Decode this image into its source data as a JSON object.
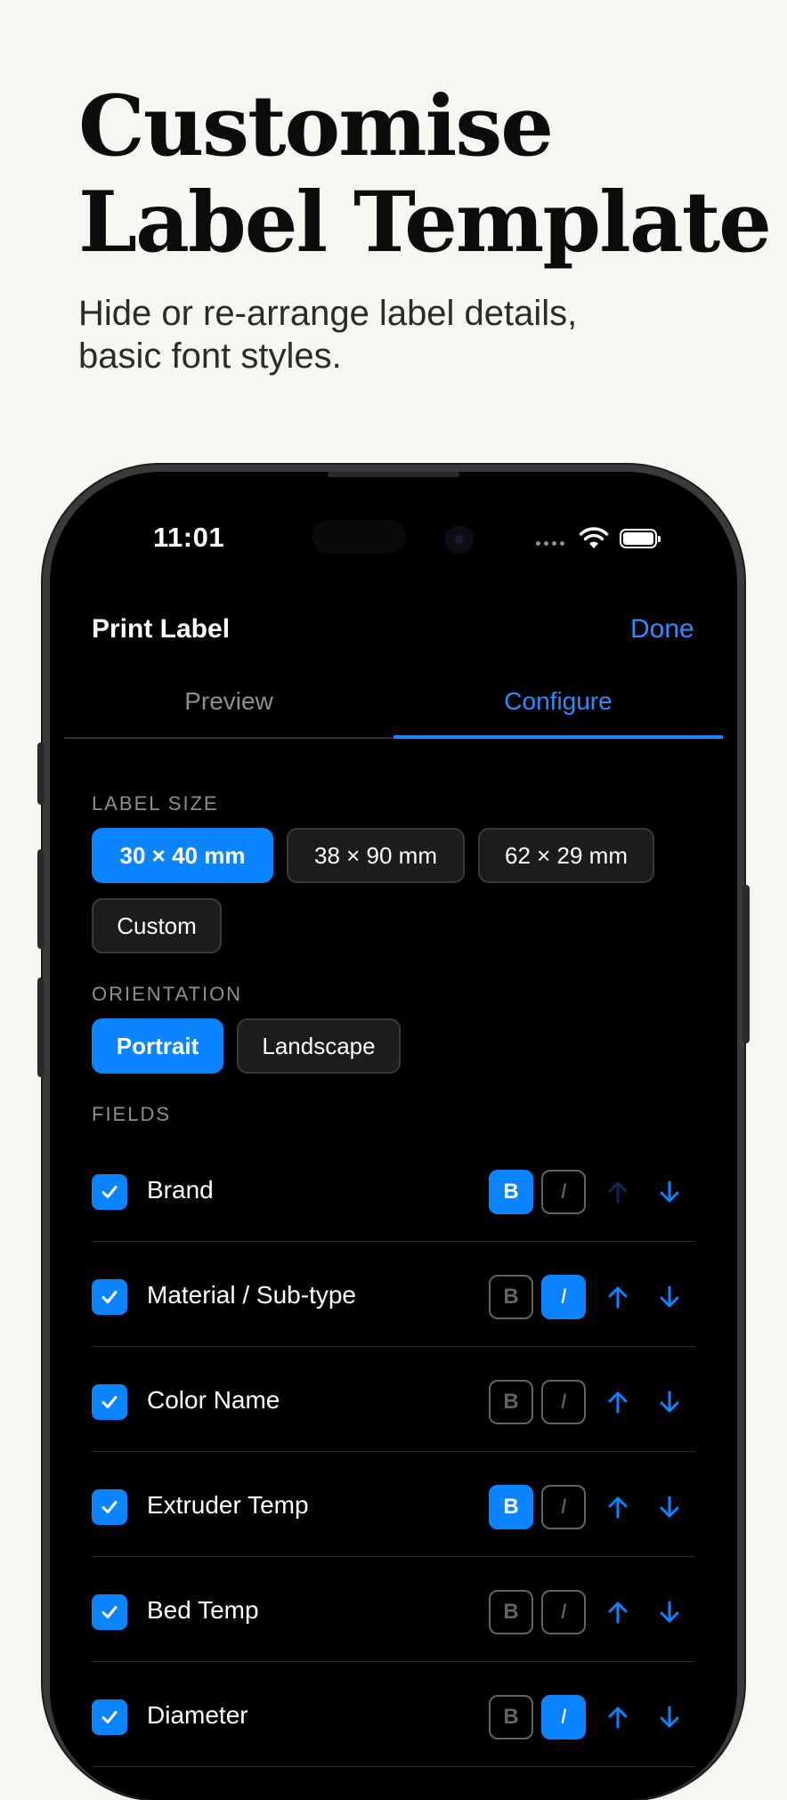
{
  "hero": {
    "title_line1": "Customise",
    "title_line2": "Label Template",
    "subtitle_line1": "Hide or re-arrange label details,",
    "subtitle_line2": "basic font styles."
  },
  "status_bar": {
    "time": "11:01"
  },
  "nav": {
    "title": "Print Label",
    "done_label": "Done"
  },
  "tabs": [
    {
      "label": "Preview",
      "selected": false
    },
    {
      "label": "Configure",
      "selected": true
    }
  ],
  "label_size": {
    "heading": "LABEL SIZE",
    "options": [
      {
        "label": "30 × 40 mm",
        "selected": true
      },
      {
        "label": "38 × 90 mm",
        "selected": false
      },
      {
        "label": "62 × 29 mm",
        "selected": false
      },
      {
        "label": "Custom",
        "selected": false
      }
    ]
  },
  "orientation": {
    "heading": "ORIENTATION",
    "options": [
      {
        "label": "Portrait",
        "selected": true
      },
      {
        "label": "Landscape",
        "selected": false
      }
    ]
  },
  "fields": {
    "heading": "FIELDS",
    "bold_glyph": "B",
    "italic_glyph": "I",
    "items": [
      {
        "name": "Brand",
        "checked": true,
        "bold": true,
        "italic": false,
        "up_enabled": false,
        "down_enabled": true
      },
      {
        "name": "Material / Sub-type",
        "checked": true,
        "bold": false,
        "italic": true,
        "up_enabled": true,
        "down_enabled": true
      },
      {
        "name": "Color Name",
        "checked": true,
        "bold": false,
        "italic": false,
        "up_enabled": true,
        "down_enabled": true
      },
      {
        "name": "Extruder Temp",
        "checked": true,
        "bold": true,
        "italic": false,
        "up_enabled": true,
        "down_enabled": true
      },
      {
        "name": "Bed Temp",
        "checked": true,
        "bold": false,
        "italic": false,
        "up_enabled": true,
        "down_enabled": true
      },
      {
        "name": "Diameter",
        "checked": true,
        "bold": false,
        "italic": true,
        "up_enabled": true,
        "down_enabled": true
      }
    ]
  },
  "colors": {
    "accent": "#0a84ff",
    "background": "#f7f7f2",
    "screen": "#000000"
  },
  "icons": {
    "checkbox": "checkmark-icon",
    "up": "arrow-up-icon",
    "down": "arrow-down-icon",
    "wifi": "wifi-icon",
    "battery": "battery-icon"
  }
}
